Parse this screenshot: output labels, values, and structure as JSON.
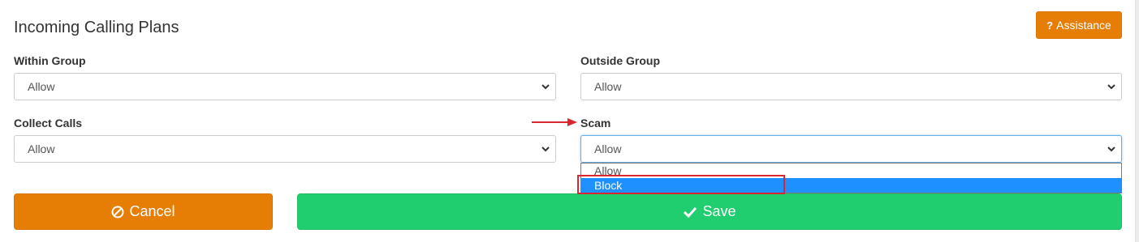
{
  "panel": {
    "title": "Incoming Calling Plans",
    "assistance_label": "Assistance",
    "assistance_icon": "question-icon"
  },
  "fields": {
    "within_group": {
      "label": "Within Group",
      "value": "Allow"
    },
    "outside_group": {
      "label": "Outside Group",
      "value": "Allow"
    },
    "collect_calls": {
      "label": "Collect Calls",
      "value": "Allow"
    },
    "scam": {
      "label": "Scam",
      "value": "Allow"
    }
  },
  "dropdown": {
    "options": [
      "Allow",
      "Block"
    ],
    "highlighted": "Block"
  },
  "buttons": {
    "cancel_label": "Cancel",
    "cancel_icon": "ban-icon",
    "save_label": "Save",
    "save_icon": "check-icon"
  },
  "colors": {
    "orange": "#e67e05",
    "green": "#20cd6f",
    "highlight_blue": "#1e90ff",
    "annotation_red": "#d9262f"
  }
}
